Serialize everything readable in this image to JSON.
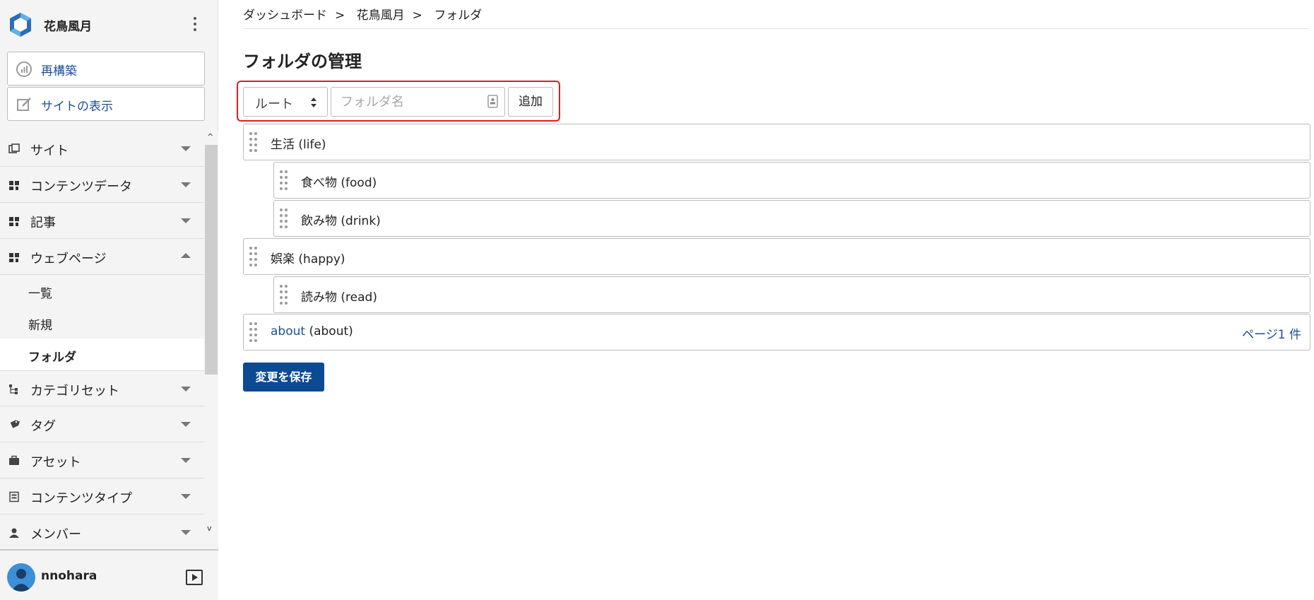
{
  "brand": {
    "site_name": "花鳥風月",
    "accent": "#1d4f95"
  },
  "sidebar": {
    "actions": [
      {
        "label": "再構築",
        "icon": "rebuild-icon"
      },
      {
        "label": "サイトの表示",
        "icon": "edit-external-icon"
      }
    ],
    "items": [
      {
        "label": "サイト",
        "icon": "site-icon",
        "expanded": false
      },
      {
        "label": "コンテンツデータ",
        "icon": "content-data-icon",
        "expanded": false
      },
      {
        "label": "記事",
        "icon": "entry-icon",
        "expanded": false
      },
      {
        "label": "ウェブページ",
        "icon": "webpage-icon",
        "expanded": true,
        "children": [
          {
            "label": "一覧",
            "active": false
          },
          {
            "label": "新規",
            "active": false
          },
          {
            "label": "フォルダ",
            "active": true
          }
        ]
      },
      {
        "label": "カテゴリセット",
        "icon": "category-set-icon",
        "expanded": false
      },
      {
        "label": "タグ",
        "icon": "tag-icon",
        "expanded": false
      },
      {
        "label": "アセット",
        "icon": "asset-icon",
        "expanded": false
      },
      {
        "label": "コンテンツタイプ",
        "icon": "content-type-icon",
        "expanded": false
      },
      {
        "label": "メンバー",
        "icon": "member-icon",
        "expanded": false
      }
    ]
  },
  "user": {
    "name": "nnohara"
  },
  "breadcrumb": [
    "ダッシュボード",
    "花鳥風月",
    "フォルダ"
  ],
  "breadcrumb_separator": ">",
  "page": {
    "title": "フォルダの管理"
  },
  "add_form": {
    "parent_select": "ルート",
    "name_placeholder": "フォルダ名",
    "add_label": "追加"
  },
  "folders": [
    {
      "label": "生活",
      "basename": "(life)",
      "level": 0
    },
    {
      "label": "食べ物",
      "basename": "(food)",
      "level": 1
    },
    {
      "label": "飲み物",
      "basename": "(drink)",
      "level": 1
    },
    {
      "label": "娯楽",
      "basename": "(happy)",
      "level": 0
    },
    {
      "label": "読み物",
      "basename": "(read)",
      "level": 1
    },
    {
      "label": "about",
      "basename": "(about)",
      "level": 0,
      "is_link": true,
      "page_count": "ページ1 件"
    }
  ],
  "save_label": "変更を保存"
}
